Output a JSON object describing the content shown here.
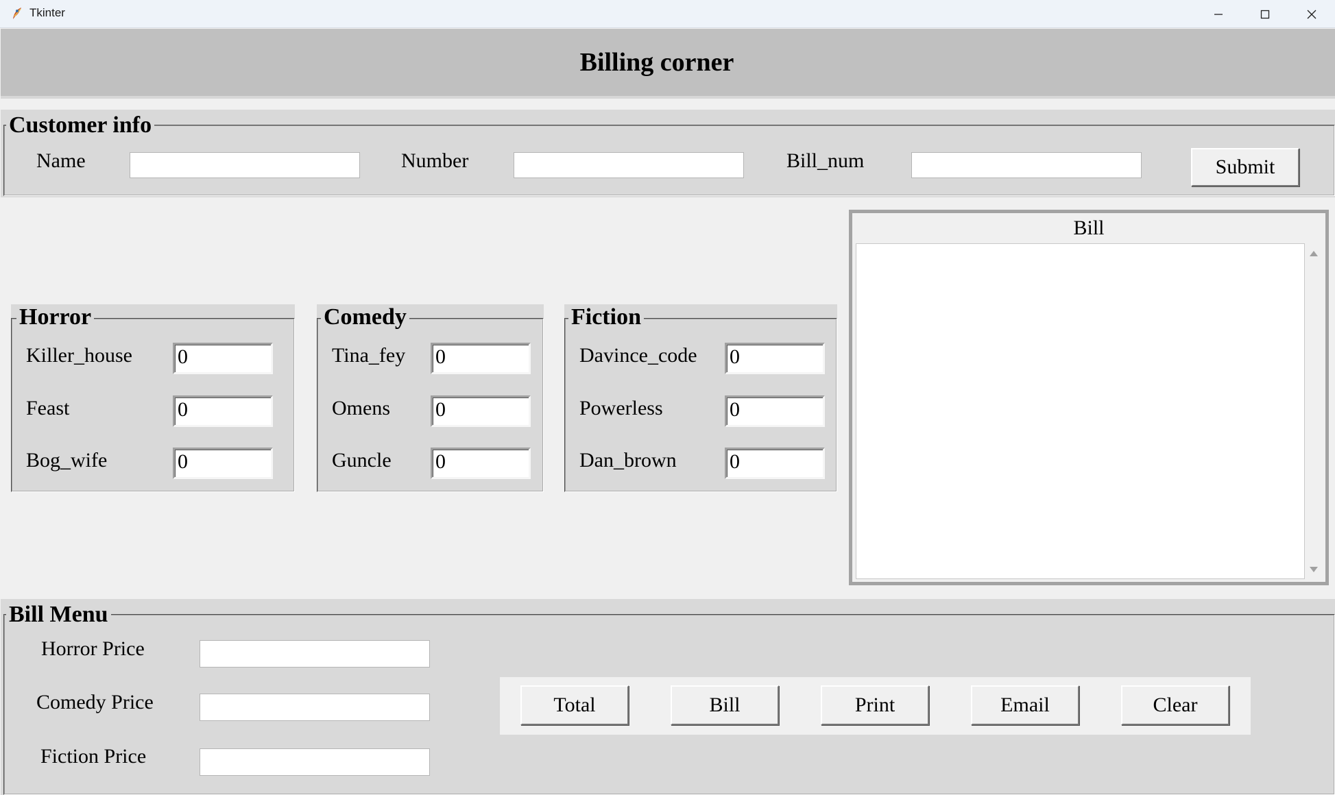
{
  "window": {
    "title": "Tkinter",
    "app_icon": "feather-icon",
    "controls": [
      "minimize-icon",
      "maximize-icon",
      "close-icon"
    ]
  },
  "heading": "Billing corner",
  "customer": {
    "legend": "Customer info",
    "name_label": "Name",
    "name_value": "",
    "number_label": "Number",
    "number_value": "",
    "billnum_label": "Bill_num",
    "billnum_value": "",
    "submit_label": "Submit"
  },
  "categories": {
    "horror": {
      "legend": "Horror",
      "items": [
        {
          "label": "Killer_house",
          "value": "0"
        },
        {
          "label": "Feast",
          "value": "0"
        },
        {
          "label": "Bog_wife",
          "value": "0"
        }
      ]
    },
    "comedy": {
      "legend": "Comedy",
      "items": [
        {
          "label": "Tina_fey",
          "value": "0"
        },
        {
          "label": "Omens",
          "value": "0"
        },
        {
          "label": "Guncle",
          "value": "0"
        }
      ]
    },
    "fiction": {
      "legend": "Fiction",
      "items": [
        {
          "label": "Davince_code",
          "value": "0"
        },
        {
          "label": "Powerless",
          "value": "0"
        },
        {
          "label": "Dan_brown",
          "value": "0"
        }
      ]
    }
  },
  "bill_panel": {
    "title": "Bill",
    "content": ""
  },
  "bill_menu": {
    "legend": "Bill Menu",
    "horror_price_label": "Horror Price",
    "horror_price_value": "",
    "comedy_price_label": "Comedy Price",
    "comedy_price_value": "",
    "fiction_price_label": "Fiction Price",
    "fiction_price_value": "",
    "buttons": [
      "Total",
      "Bill",
      "Print",
      "Email",
      "Clear"
    ]
  }
}
